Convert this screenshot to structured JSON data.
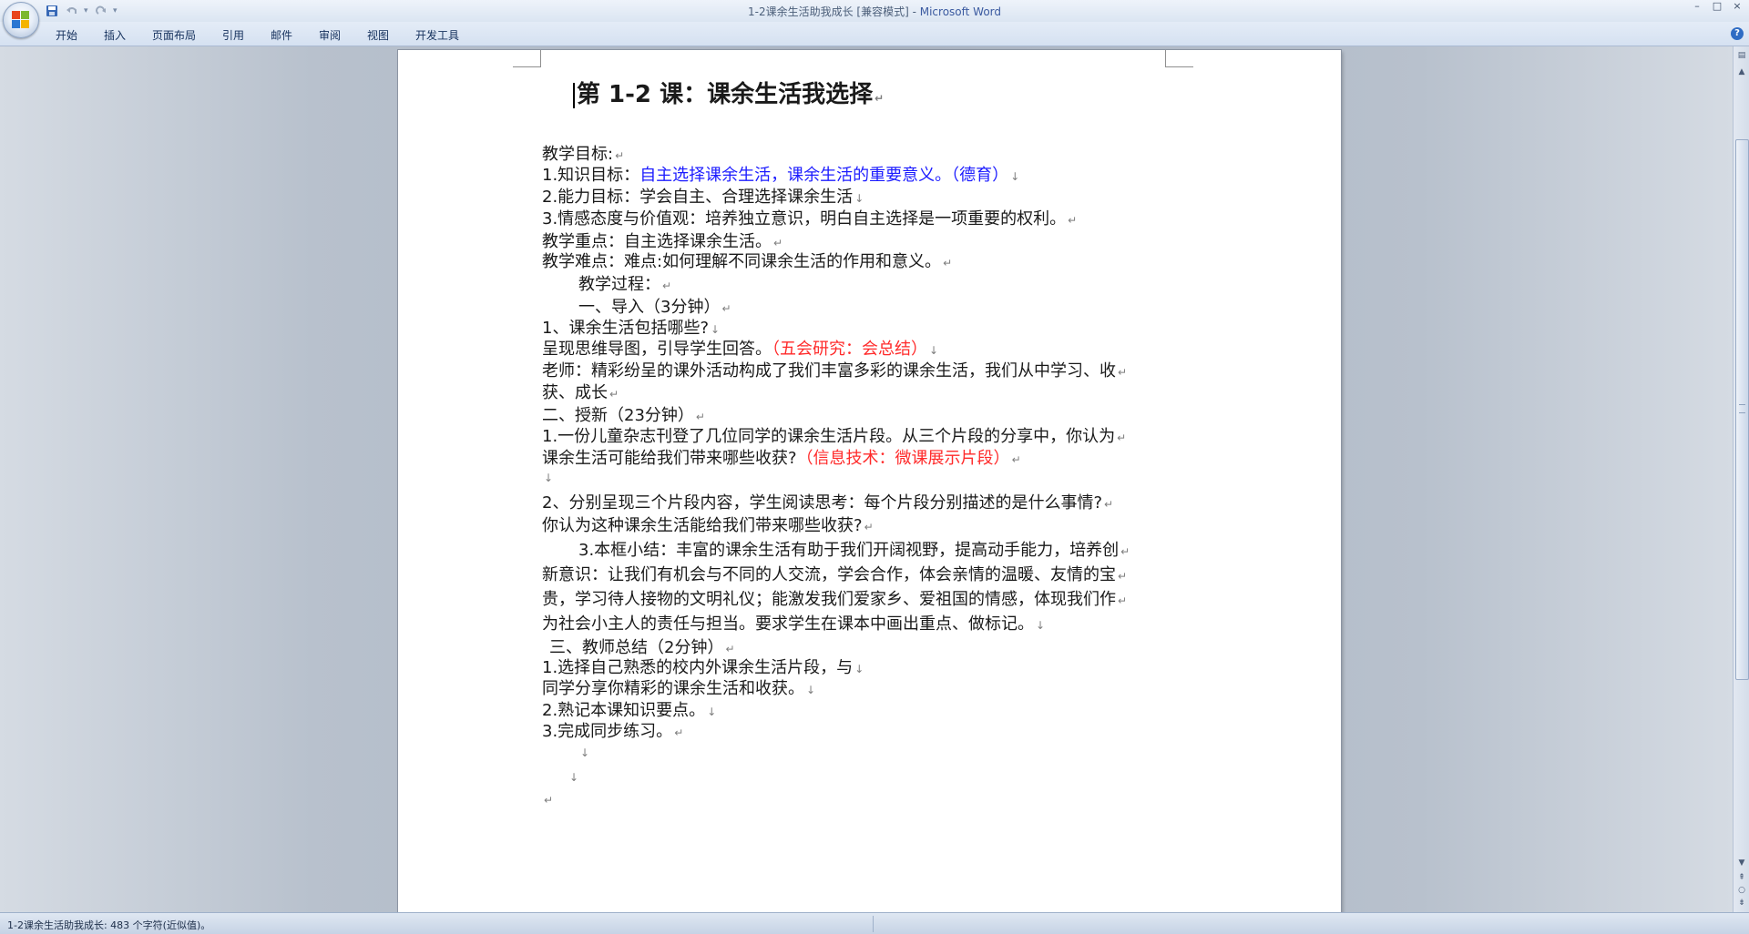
{
  "window": {
    "doc_name": "1-2课余生活助我成长 [兼容模式]",
    "separator": " - ",
    "app_name": "Microsoft Word",
    "minimize": "–",
    "maximize": "□",
    "close": "×"
  },
  "quick_access": {
    "more": "▾"
  },
  "ribbon": {
    "tabs": [
      "开始",
      "插入",
      "页面布局",
      "引用",
      "邮件",
      "审阅",
      "视图",
      "开发工具"
    ],
    "help": "?"
  },
  "document": {
    "title": "第 1-2 课：课余生活我选择",
    "lines": [
      {
        "text": "教学目标:"
      },
      {
        "prefix": "1.知识目标：",
        "text": "自主选择课余生活，课余生活的重要意义。（德育）",
        "color": "blue"
      },
      {
        "text": "2.能力目标：学会自主、合理选择课余生活"
      },
      {
        "text": "3.情感态度与价值观：培养独立意识，明白自主选择是一项重要的权利。"
      },
      {
        "text": "教学重点：自主选择课余生活。"
      },
      {
        "text": "教学难点：难点:如何理解不同课余生活的作用和意义。"
      },
      {
        "text": "教学过程："
      },
      {
        "text": "一、导入（3分钟）"
      },
      {
        "text": "1、课余生活包括哪些?"
      },
      {
        "prefix": "呈现思维导图，引导学生回答。",
        "text": "（五会研究：会总结）",
        "color": "red"
      },
      {
        "text": "老师：精彩纷呈的课外活动构成了我们丰富多彩的课余生活，我们从中学习、收"
      },
      {
        "text": "获、成长"
      },
      {
        "text": "二、授新（23分钟）"
      },
      {
        "text": "1.一份儿童杂志刊登了几位同学的课余生活片段。从三个片段的分享中，你认为"
      },
      {
        "prefix": "课余生活可能给我们带来哪些收获?",
        "text": "（信息技术：微课展示片段）",
        "color": "red"
      },
      {
        "text": ""
      },
      {
        "text": "2、分别呈现三个片段内容，学生阅读思考：每个片段分别描述的是什么事情?"
      },
      {
        "text": "你认为这种课余生活能给我们带来哪些收获?"
      },
      {
        "text": "3.本框小结：丰富的课余生活有助于我们开阔视野，提高动手能力，培养创"
      },
      {
        "text": "新意识：让我们有机会与不同的人交流，学会合作，体会亲情的温暖、友情的宝"
      },
      {
        "text": "贵，学习待人接物的文明礼仪；能激发我们爱家乡、爱祖国的情感，体现我们作"
      },
      {
        "text": "为社会小主人的责任与担当。要求学生在课本中画出重点、做标记。"
      },
      {
        "text": "三、教师总结（2分钟）"
      },
      {
        "text": "1.选择自己熟悉的校内外课余生活片段，与"
      },
      {
        "text": "同学分享你精彩的课余生活和收获。"
      },
      {
        "text": "2.熟记本课知识要点。"
      },
      {
        "text": "3.完成同步练习。"
      },
      {
        "text": ""
      },
      {
        "text": ""
      },
      {
        "text": ""
      }
    ],
    "paragraph_mark": "↵",
    "line_break_mark": "↓"
  },
  "status": {
    "text": "1-2课余生活助我成长: 483 个字符(近似值)。"
  },
  "colors": {
    "blue_text": "#1c1cff",
    "red_text": "#ff2a2a",
    "ribbon_text": "#15315d",
    "app_title": "#3b5aa0"
  },
  "icons": [
    "office-logo-icon",
    "save-icon",
    "undo-icon",
    "redo-icon",
    "help-icon",
    "scroll-up-arrow-icon",
    "scroll-down-arrow-icon",
    "prev-page-icon",
    "next-page-icon",
    "browse-object-icon",
    "ruler-toggle-icon"
  ]
}
